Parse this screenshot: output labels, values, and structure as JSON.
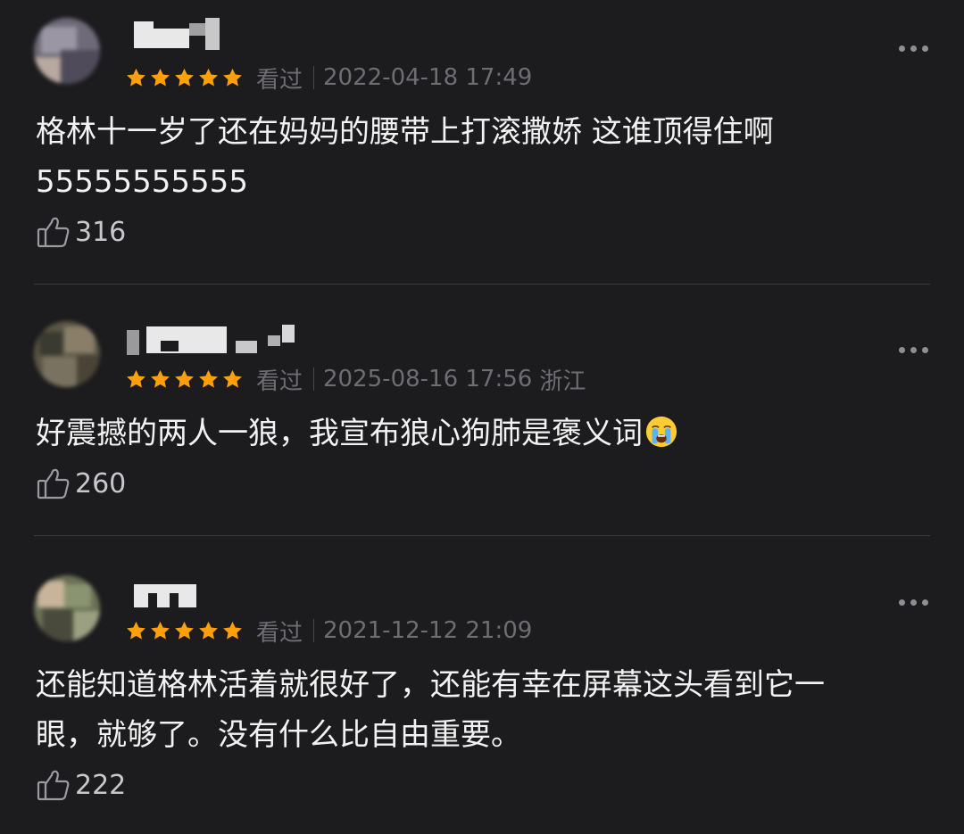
{
  "comments": [
    {
      "rating": 5,
      "status": "看过",
      "date": "2022-04-18 17:49",
      "region": "",
      "text_line1": "格林十一岁了还在妈妈的腰带上打滚撒娇 这谁顶得住啊",
      "text_line2": "55555555555",
      "likes": "316"
    },
    {
      "rating": 5,
      "status": "看过",
      "date": "2025-08-16 17:56",
      "region": "浙江",
      "text": "好震撼的两人一狼，我宣布狼心狗肺是褒义词",
      "emoji": "crying-face-emoji",
      "likes": "260"
    },
    {
      "rating": 5,
      "status": "看过",
      "date": "2021-12-12 21:09",
      "region": "",
      "text_line1": "还能知道格林活着就很好了，还能有幸在屏幕这头看到它一",
      "text_line2": "眼，就够了。没有什么比自由重要。",
      "likes": "222"
    }
  ],
  "colors": {
    "background": "#1c1c1e",
    "star": "#ff9f0a",
    "meta_text": "#6d6d72",
    "body_text": "#f2f2f2",
    "divider": "#38383a"
  },
  "icons": {
    "like": "thumbs-up-icon",
    "more": "more-dots-icon",
    "star": "star-icon"
  }
}
